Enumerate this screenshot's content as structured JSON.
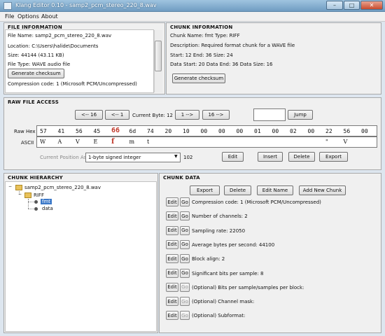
{
  "window": {
    "title": "Klang Editor 0.10 - samp2_pcm_stereo_220_8.wav"
  },
  "menu": [
    "File",
    "Options",
    "About"
  ],
  "file_info": {
    "title": "FILE INFORMATION",
    "lines": [
      "File Name: samp2_pcm_stereo_220_8.wav",
      "Location: C:\\Users\\halide\\Documents",
      "Size: 44144 (43.11 KB)",
      "File Type: WAVE audio file"
    ],
    "checksum_button": "Generate checksum",
    "compression": "Compression code: 1 (Microsoft PCM/Uncompressed)"
  },
  "chunk_info": {
    "title": "CHUNK INFORMATION",
    "lines": [
      "Chunk Name: fmt   Type: RIFF",
      "Description: Required format chunk for a WAVE file",
      "Start: 12  End: 36  Size: 24",
      "Data Start: 20  Data End: 36  Data Size: 16"
    ],
    "checksum_button": "Generate checksum"
  },
  "raw": {
    "title": "RAW FILE ACCESS",
    "nav": [
      "<-- 16",
      "<-- 1",
      "1 -->",
      "16 -->"
    ],
    "current_byte_label": "Current Byte: 12",
    "jump_value": "",
    "jump_button": "Jump",
    "hex_label": "Raw Hex",
    "ascii_label": "ASCII",
    "hex": [
      "57",
      "41",
      "56",
      "45",
      "66",
      "6d",
      "74",
      "20",
      "10",
      "00",
      "00",
      "00",
      "01",
      "00",
      "02",
      "00",
      "22",
      "56",
      "00"
    ],
    "ascii": [
      "W",
      "A",
      "V",
      "E",
      "f",
      "m",
      "t",
      "",
      "",
      "",
      "",
      "",
      "",
      "",
      "",
      "",
      "\"",
      "V",
      ""
    ],
    "highlight_index": 4,
    "position_label": "Current Position As:",
    "position_type": "1-byte signed integer",
    "position_value": "102",
    "edit_button": "Edit",
    "insert_button": "Insert",
    "delete_button": "Delete",
    "export_button": "Export"
  },
  "hierarchy": {
    "title": "CHUNK HIERARCHY",
    "root": "samp2_pcm_stereo_220_8.wav",
    "riff": "RIFF",
    "children": [
      "fmt",
      "data"
    ]
  },
  "chunk_data": {
    "title": "CHUNK DATA",
    "buttons": [
      "Export",
      "Delete",
      "Edit Name",
      "Add New Chunk"
    ],
    "edit_label": "Edit",
    "go_label": "Go",
    "rows": [
      {
        "text": "Compression code: 1 (Microsoft PCM/Uncompressed)",
        "go_enabled": true
      },
      {
        "text": "Number of channels: 2",
        "go_enabled": true
      },
      {
        "text": "Sampling rate: 22050",
        "go_enabled": true
      },
      {
        "text": "Average bytes per second: 44100",
        "go_enabled": true
      },
      {
        "text": "Block align: 2",
        "go_enabled": true
      },
      {
        "text": "Significant bits per sample: 8",
        "go_enabled": true
      },
      {
        "text": "(Optional) Bits per sample/samples per block:",
        "go_enabled": false
      },
      {
        "text": "(Optional) Channel mask:",
        "go_enabled": false
      },
      {
        "text": "(Optional) Subformat:",
        "go_enabled": false
      }
    ]
  },
  "window_controls": {
    "minimize": "–",
    "maximize": "□",
    "close": "✕"
  }
}
